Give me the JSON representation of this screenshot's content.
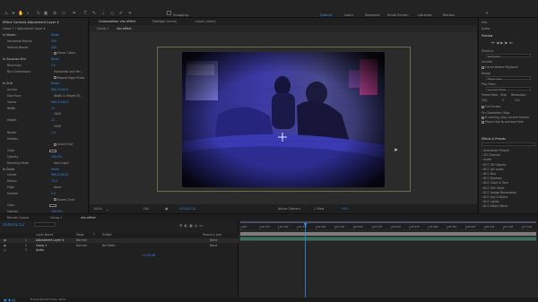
{
  "toolbar": {
    "snapping_label": "Snapping",
    "workspaces": [
      "Default",
      "Learn",
      "Standard",
      "Small Screen",
      "Libraries",
      "Review"
    ],
    "active_workspace": "Default"
  },
  "effect_controls": {
    "tab_label": "Effect Controls Adjustment Layer 4",
    "header": "Comp 1 • Adjustment Layer 4",
    "rows": [
      {
        "label": "fx  Mosaic",
        "value": "Reset"
      },
      {
        "label": "Horizontal Blocks",
        "value": "100"
      },
      {
        "label": "Vertical Blocks",
        "value": "100"
      },
      {
        "label": "",
        "value": "",
        "check": "Sharp Colors"
      },
      {
        "label": "fx  Gaussian Blur",
        "value": "Reset"
      },
      {
        "label": "Blurriness",
        "value": "2.0"
      },
      {
        "label": "Blur Dimensions",
        "value": "",
        "text2": "Horizontal and Ver..."
      },
      {
        "label": "",
        "value": "",
        "check": "Repeat Edge Pixels"
      },
      {
        "label": "fx  Grid",
        "value": "Reset"
      },
      {
        "label": "Anchor",
        "value": "960.0,540.0"
      },
      {
        "label": "Size From",
        "value": "",
        "text2": "Width & Height Sli..."
      },
      {
        "label": "Corner",
        "value": "960.0,540.0"
      },
      {
        "label": "Width",
        "value": "12"
      },
      {
        "label": "",
        "value": "",
        "text2": "1000"
      },
      {
        "label": "Height",
        "value": "12"
      },
      {
        "label": "",
        "value": "",
        "text2": "1000"
      },
      {
        "label": "Border",
        "value": "1.0"
      },
      {
        "label": "Feather",
        "value": ""
      },
      {
        "label": "",
        "value": "",
        "check": "Invert Grid"
      },
      {
        "label": "Color",
        "value": "",
        "swatch": true
      },
      {
        "label": "Opacity",
        "value": "100.0%"
      },
      {
        "label": "Blending Mode",
        "value": "",
        "text2": "Hard Light"
      },
      {
        "label": "fx  Circle",
        "value": "Reset"
      },
      {
        "label": "Center",
        "value": "960.0,540.0"
      },
      {
        "label": "Radius",
        "value": "75.0"
      },
      {
        "label": "Edge",
        "value": "",
        "text2": "None"
      },
      {
        "label": "Feather",
        "value": "0.0"
      },
      {
        "label": "",
        "value": "",
        "check": "Invert Circle"
      },
      {
        "label": "Color",
        "value": "",
        "swatch": true
      },
      {
        "label": "Opacity",
        "value": "100.0%"
      }
    ]
  },
  "composition": {
    "tab_label": "Composition vhs effect",
    "footage_tab": "Footage (none)",
    "layer_tab": "Layer (none)",
    "subtabs": [
      "Comp 1",
      "vhs effect"
    ],
    "zoom": "100%",
    "timecode": "0;00;01;12",
    "quality": "Full",
    "view_label": "Active Camera",
    "views": "1 View",
    "exposure": "+0.0"
  },
  "right_panel": {
    "info_label": "Info",
    "audio_label": "Audio",
    "preview_label": "Preview",
    "shortcut_label": "Shortcut",
    "shortcut_value": "Spacebar",
    "include_label": "Include:",
    "cache_label": "Cache Before Playback",
    "range_label": "Range",
    "range_value": "Work Area",
    "play_from_label": "Play From",
    "play_from_value": "Current Time",
    "frame_rate_label": "Frame Rate",
    "skip_label": "Skip",
    "resolution_label": "Resolution",
    "frame_rate_value": "(30)",
    "skip_value": "0",
    "resolution_value": "Full",
    "fullscreen_label": "Full Screen",
    "on_stop_label": "On (Spacebar) Stop:",
    "if_caching_label": "If caching, play cached frames",
    "move_time_label": "Move time to preview time",
    "effects_label": "Effects & Presets",
    "effects": [
      "Animation Presets",
      "3D Channel",
      "Audio",
      "BCC 3D Objects",
      "BCC Art Looks",
      "BCC Blur",
      "BCC Browser",
      "BCC Color & Tone",
      "BCC Film Style",
      "BCC Image Restoration",
      "BCC Key & Blend",
      "BCC Lights",
      "BCC Match Move"
    ]
  },
  "timeline": {
    "render_queue_tab": "Render Queue",
    "comp1_tab": "Comp 1",
    "vhs_tab": "vhs effect",
    "timecode": "0;00;01;12",
    "columns": [
      "Layer Name",
      "Mode",
      "T",
      "TrkMat",
      "Parent & Link"
    ],
    "layers": [
      {
        "num": "1",
        "name": "Adjustment Layer 4",
        "mode": "Normal",
        "trkmat": "",
        "parent": "None"
      },
      {
        "num": "2",
        "name": "Comp 1",
        "mode": "Normal",
        "trkmat": "No Matte",
        "parent": "None"
      },
      {
        "num": "3",
        "name": "Audio",
        "mode": "",
        "trkmat": "",
        "parent": ""
      }
    ],
    "ruler": [
      "00f",
      "00:15f",
      "01:00f",
      "01:15f",
      "02:00f",
      "02:15f",
      "03:00f",
      "03:15f",
      "04:00f",
      "04:15f",
      "05:00f",
      "05:15f",
      "06:00f",
      "06:15f",
      "07:00f",
      "07:15f"
    ],
    "audio_value": "+0.00 dB",
    "status": "Frame Render Time: 20ms",
    "playhead_fraction": 0.22
  },
  "colors": {
    "accent": "#2d8ceb",
    "layer_bar": "#8c8c8c",
    "comp_bar": "#3f7c6a",
    "work_area": "#4b4b6a"
  }
}
